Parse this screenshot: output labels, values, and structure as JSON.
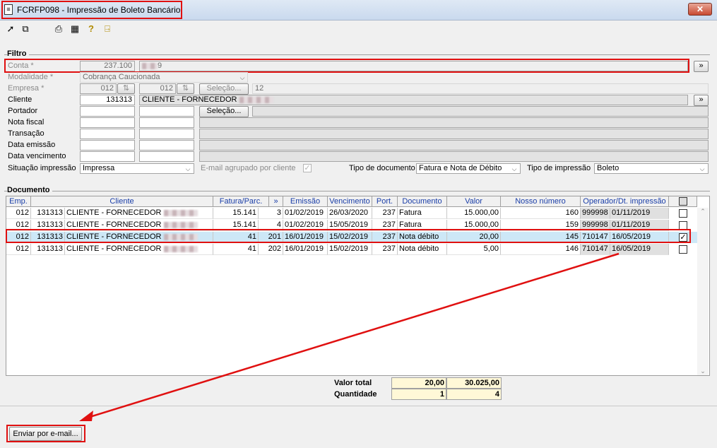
{
  "window": {
    "title": "FCRFP098 - Impressão de Boleto Bancário",
    "close_glyph": "✕"
  },
  "filtro": {
    "group_label": "Filtro",
    "conta": {
      "label": "Conta *",
      "value": "237.100",
      "desc": "9"
    },
    "modalidade": {
      "label": "Modalidade *",
      "value": "Cobrança Caucionada"
    },
    "empresa": {
      "label": "Empresa *",
      "from": "012",
      "to": "012",
      "button": "Seleção...",
      "count": "12"
    },
    "cliente": {
      "label": "Cliente",
      "value": "131313",
      "desc": "CLIENTE - FORNECEDOR"
    },
    "portador": {
      "label": "Portador",
      "button": "Seleção..."
    },
    "nota_fiscal": {
      "label": "Nota fiscal"
    },
    "transacao": {
      "label": "Transação"
    },
    "data_emissao": {
      "label": "Data emissão"
    },
    "data_vencimento": {
      "label": "Data vencimento"
    },
    "situacao": {
      "label": "Situação impressão",
      "value": "Impressa"
    },
    "email_agrupado": {
      "label": "E-mail agrupado por cliente"
    },
    "tipo_documento": {
      "label": "Tipo de documento",
      "value": "Fatura e Nota de Débito"
    },
    "tipo_impressao": {
      "label": "Tipo de impressão",
      "value": "Boleto"
    },
    "expand_glyph": "»"
  },
  "documento": {
    "group_label": "Documento",
    "columns": [
      "Emp.",
      "Cliente",
      "Fatura/Parc.",
      "»",
      "Emissão",
      "Vencimento",
      "Port.",
      "Documento",
      "Valor",
      "Nosso número",
      "Operador/Dt. impressão"
    ],
    "rows": [
      {
        "emp": "012",
        "cod": "131313",
        "cliente": "CLIENTE - FORNECEDOR",
        "fatura": "15.141",
        "parc": "3",
        "emissao": "01/02/2019",
        "vencimento": "26/03/2020",
        "port": "237",
        "documento": "Fatura",
        "valor": "15.000,00",
        "nosso": "160",
        "operador": "999998",
        "dt_impressao": "01/11/2019",
        "checked": ""
      },
      {
        "emp": "012",
        "cod": "131313",
        "cliente": "CLIENTE - FORNECEDOR",
        "fatura": "15.141",
        "parc": "4",
        "emissao": "01/02/2019",
        "vencimento": "15/05/2019",
        "port": "237",
        "documento": "Fatura",
        "valor": "15.000,00",
        "nosso": "159",
        "operador": "999998",
        "dt_impressao": "01/11/2019",
        "checked": ""
      },
      {
        "emp": "012",
        "cod": "131313",
        "cliente": "CLIENTE - FORNECEDOR",
        "fatura": "41",
        "parc": "201",
        "emissao": "16/01/2019",
        "vencimento": "15/02/2019",
        "port": "237",
        "documento": "Nota débito",
        "valor": "20,00",
        "nosso": "145",
        "operador": "710147",
        "dt_impressao": "16/05/2019",
        "checked": "✓"
      },
      {
        "emp": "012",
        "cod": "131313",
        "cliente": "CLIENTE - FORNECEDOR",
        "fatura": "41",
        "parc": "202",
        "emissao": "16/01/2019",
        "vencimento": "15/02/2019",
        "port": "237",
        "documento": "Nota débito",
        "valor": "5,00",
        "nosso": "146",
        "operador": "710147",
        "dt_impressao": "16/05/2019",
        "checked": ""
      }
    ],
    "totals": {
      "valor_label": "Valor total",
      "valor_sel": "20,00",
      "valor_all": "30.025,00",
      "qtd_label": "Quantidade",
      "qtd_sel": "1",
      "qtd_all": "4"
    }
  },
  "footer": {
    "email_button": "Enviar por e-mail..."
  },
  "icons": [
    "export-icon",
    "copy-icon",
    "print-icon",
    "calendar-grid-icon",
    "help-icon",
    "exit-icon"
  ],
  "colors": {
    "highlight_border": "#e01010",
    "selected_row": "#cde8f7",
    "header_text": "#1a3ea8"
  }
}
